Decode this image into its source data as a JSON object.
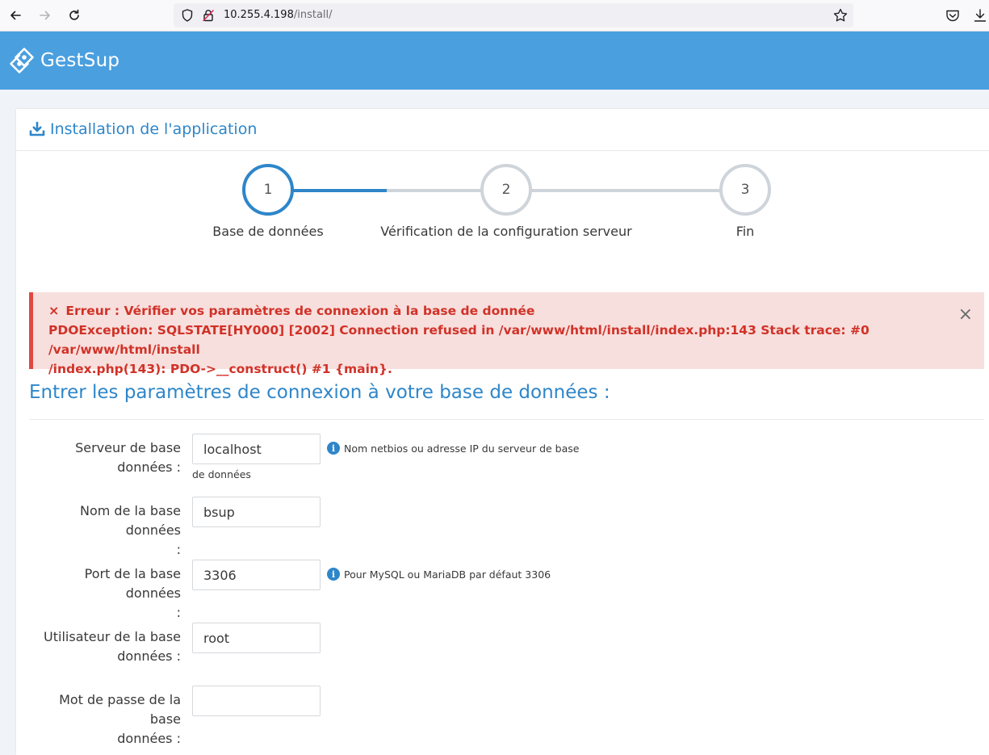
{
  "browser": {
    "url_host": "10.255.4.198",
    "url_path": "/install/"
  },
  "app": {
    "name": "GestSup",
    "header_color": "#4a9fdf"
  },
  "panel": {
    "title": "Installation de l'application"
  },
  "steps": [
    {
      "number": "1",
      "label": "Base de données",
      "active": true
    },
    {
      "number": "2",
      "label": "Vérification de la configuration serveur",
      "active": false
    },
    {
      "number": "3",
      "label": "Fin",
      "active": false
    }
  ],
  "alert": {
    "icon": "×",
    "title": "Erreur : Vérifier vos paramètres de connexion à la base de donnée",
    "message_line1": "PDOException: SQLSTATE[HY000] [2002] Connection refused in /var/www/html/install/index.php:143 Stack trace: #0 /var/www/html/install",
    "message_line2": "/index.php(143): PDO->__construct() #1 {main}.",
    "close": "×",
    "color": "#d13228"
  },
  "form": {
    "heading": "Entrer les paramètres de connexion à votre base de données :",
    "fields": {
      "server": {
        "label_line1": "Serveur de base",
        "label_line2": "données :",
        "value": "localhost",
        "help": "Nom netbios ou adresse IP du serveur de base",
        "help_cont": "de données"
      },
      "dbname": {
        "label_line1": "Nom de la base données",
        "label_line2": ":",
        "value": "bsup"
      },
      "port": {
        "label_line1": "Port de la base données",
        "label_line2": ":",
        "value": "3306",
        "help": "Pour MySQL ou MariaDB par défaut 3306"
      },
      "user": {
        "label_line1": "Utilisateur de la base",
        "label_line2": "données :",
        "value": "root"
      },
      "password": {
        "label_line1": "Mot de passe de la base",
        "label_line2": "données :",
        "value": ""
      }
    }
  },
  "icons": {
    "back": "back-arrow-icon",
    "forward": "forward-arrow-icon",
    "reload": "reload-icon",
    "info": "info-icon"
  }
}
